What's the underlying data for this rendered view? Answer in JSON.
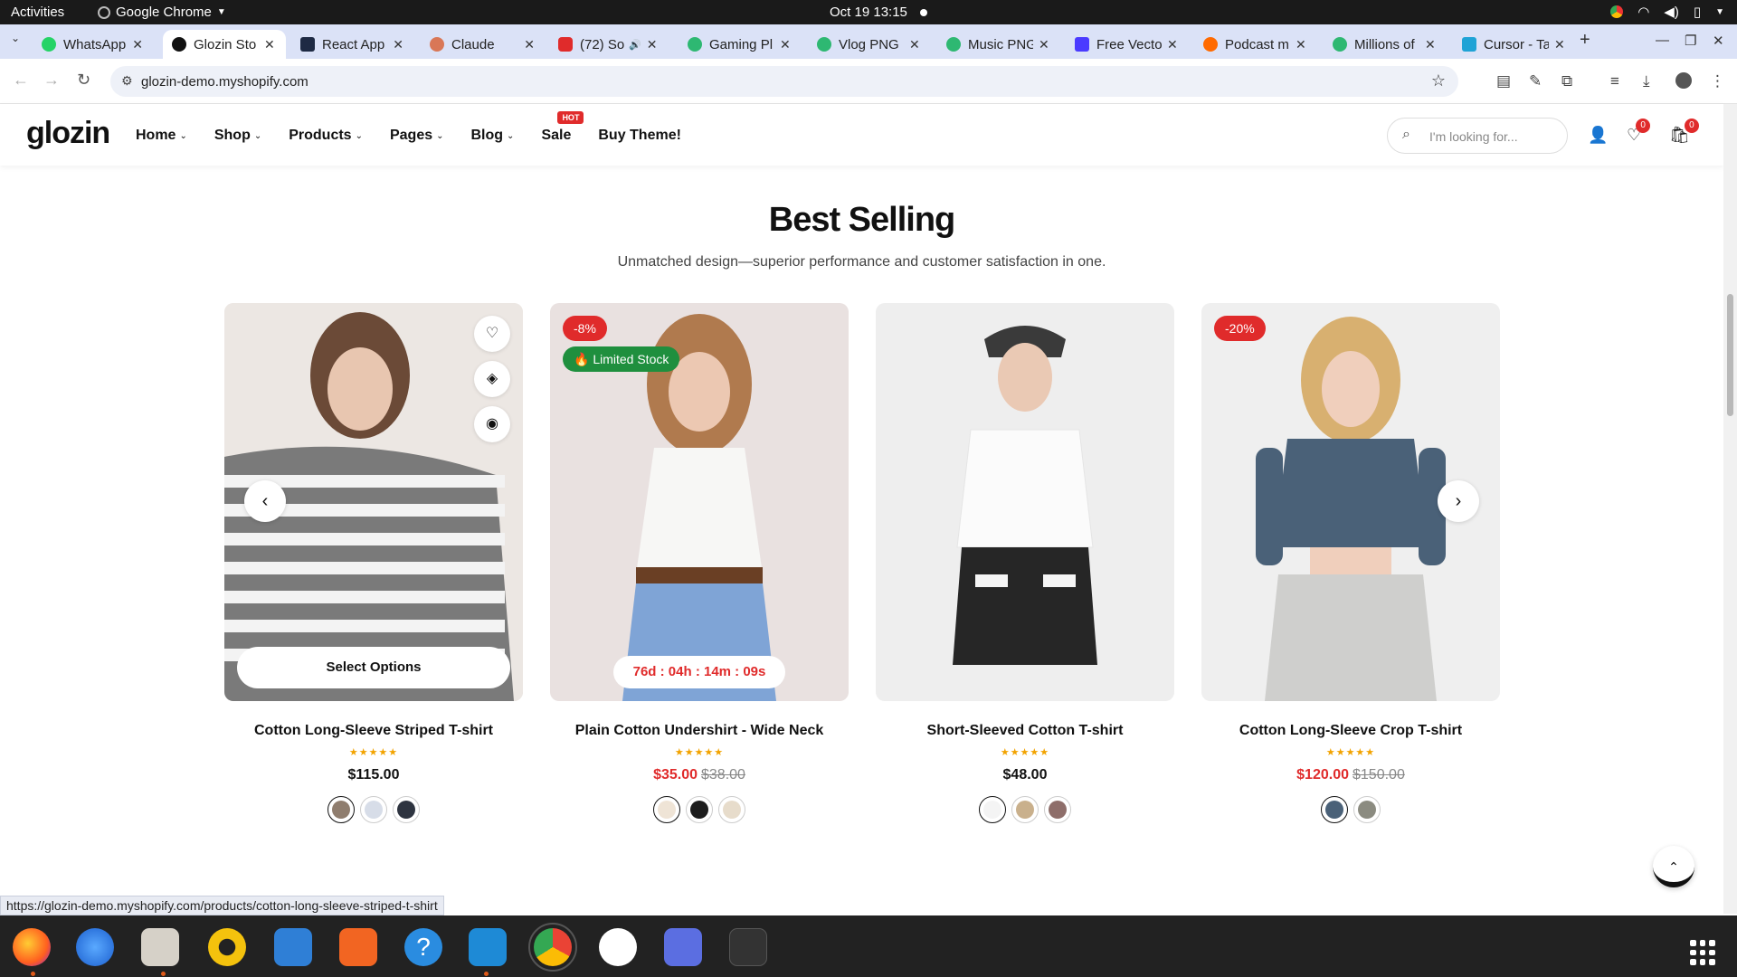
{
  "system": {
    "activities": "Activities",
    "app_name": "Google Chrome",
    "clock": "Oct 19  13:15"
  },
  "tabs": [
    {
      "title": "WhatsApp",
      "color": "#25d366"
    },
    {
      "title": "Glozin Sto",
      "color": "#111111"
    },
    {
      "title": "React App",
      "color": "#1e2a44"
    },
    {
      "title": "Claude",
      "color": "#d97757"
    },
    {
      "title": "(72) So",
      "color": "#e02b2b"
    },
    {
      "title": "Gaming Pl",
      "color": "#2eb872"
    },
    {
      "title": "Vlog PNG",
      "color": "#2eb872"
    },
    {
      "title": "Music PNG",
      "color": "#2eb872"
    },
    {
      "title": "Free Vecto",
      "color": "#4a3aff"
    },
    {
      "title": "Podcast m",
      "color": "#ff6a00"
    },
    {
      "title": "Millions of",
      "color": "#2eb872"
    },
    {
      "title": "Cursor - Ta",
      "color": "#1fa3d6"
    }
  ],
  "address": {
    "url": "glozin-demo.myshopify.com"
  },
  "site": {
    "logo": "glozin",
    "menu": [
      "Home",
      "Shop",
      "Products",
      "Pages",
      "Blog",
      "Sale",
      "Buy Theme!"
    ],
    "hot_badge": "HOT",
    "search_placeholder": "I'm looking for...",
    "wishlist_count": "0",
    "cart_count": "0"
  },
  "section": {
    "title": "Best Selling",
    "subtitle": "Unmatched design—superior performance and customer satisfaction in one."
  },
  "products": [
    {
      "name": "Cotton Long-Sleeve Striped T-shirt",
      "stars": "★★★★★",
      "price": "$115.00",
      "sale_price": "",
      "old_price": "",
      "cta": "Select Options",
      "swatches": [
        "#8f7d6e",
        "#d7dde8",
        "#2e3440"
      ]
    },
    {
      "name": "Plain Cotton Undershirt - Wide Neck",
      "stars": "★★★★★",
      "price": "",
      "sale_price": "$35.00",
      "old_price": "$38.00",
      "discount": "-8%",
      "stock_label": "🔥 Limited Stock",
      "countdown": "76d : 04h : 14m : 09s",
      "swatches": [
        "#efe4d6",
        "#1d1d1d",
        "#e7dccb"
      ]
    },
    {
      "name": "Short-Sleeved Cotton T-shirt",
      "stars": "★★★★★",
      "price": "$48.00",
      "sale_price": "",
      "old_price": "",
      "swatches": [
        "#f4f4f4",
        "#c9b08c",
        "#8e6e6a"
      ]
    },
    {
      "name": "Cotton Long-Sleeve Crop T-shirt",
      "stars": "★★★★★",
      "price": "",
      "sale_price": "$120.00",
      "old_price": "$150.00",
      "discount": "-20%",
      "swatches": [
        "#4a6178",
        "#8b8b80"
      ]
    }
  ],
  "status_url": "https://glozin-demo.myshopify.com/products/cotton-long-sleeve-striped-t-shirt",
  "colors": {
    "accent_red": "#e02b2b",
    "stock_green": "#1f8f3e",
    "star_gold": "#f2a300"
  }
}
